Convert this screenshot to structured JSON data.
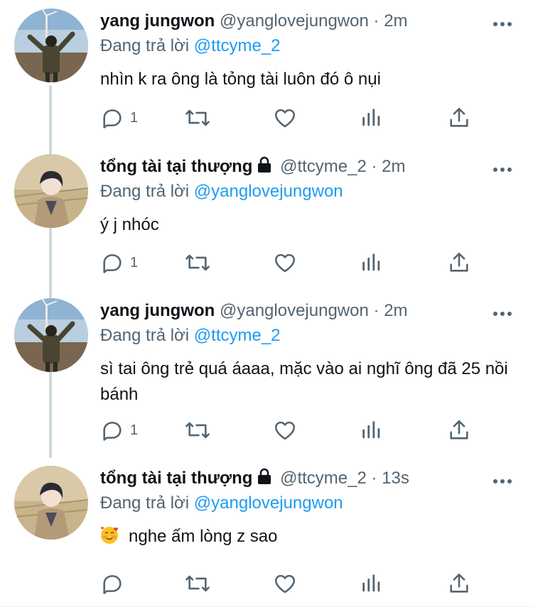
{
  "tweets": [
    {
      "name": "yang jungwon",
      "handle": "@yanglovejungwon",
      "time": "2m",
      "reply_prefix": "Đang trả lời",
      "reply_to": "@ttcyme_2",
      "text": "nhìn k ra ông là tỏng tài luôn đó ô nụi",
      "reply_count": "1",
      "avatar": "jungwon-photo",
      "locked": false
    },
    {
      "name": "tổng tài tại thượng",
      "handle": "@ttcyme_2",
      "time": "2m",
      "reply_prefix": "Đang trả lời",
      "reply_to": "@yanglovejungwon",
      "text": "ý j nhóc",
      "reply_count": "1",
      "avatar": "anime-photo",
      "locked": true
    },
    {
      "name": "yang jungwon",
      "handle": "@yanglovejungwon",
      "time": "2m",
      "reply_prefix": "Đang trả lời",
      "reply_to": "@ttcyme_2",
      "text": "sì tai ông trẻ quá áaaa, mặc vào ai nghĩ ông đã 25 nồi bánh",
      "reply_count": "1",
      "avatar": "jungwon-photo",
      "locked": false
    },
    {
      "name": "tổng tài tại thượng",
      "handle": "@ttcyme_2",
      "time": "13s",
      "reply_prefix": "Đang trả lời",
      "reply_to": "@yanglovejungwon",
      "text": "nghe ấm lòng z sao",
      "emoji": "smiling-face-with-hearts",
      "reply_count": "",
      "avatar": "anime-photo",
      "locked": true
    }
  ],
  "separator": "·",
  "icons": {
    "reply": "reply-icon",
    "retweet": "retweet-icon",
    "like": "heart-icon",
    "views": "analytics-icon",
    "share": "share-icon",
    "more": "more-icon",
    "lock": "lock-icon"
  },
  "colors": {
    "text": "#0f1419",
    "secondary": "#536471",
    "mention": "#1d9bf0",
    "thread_line": "#cfd9de"
  }
}
